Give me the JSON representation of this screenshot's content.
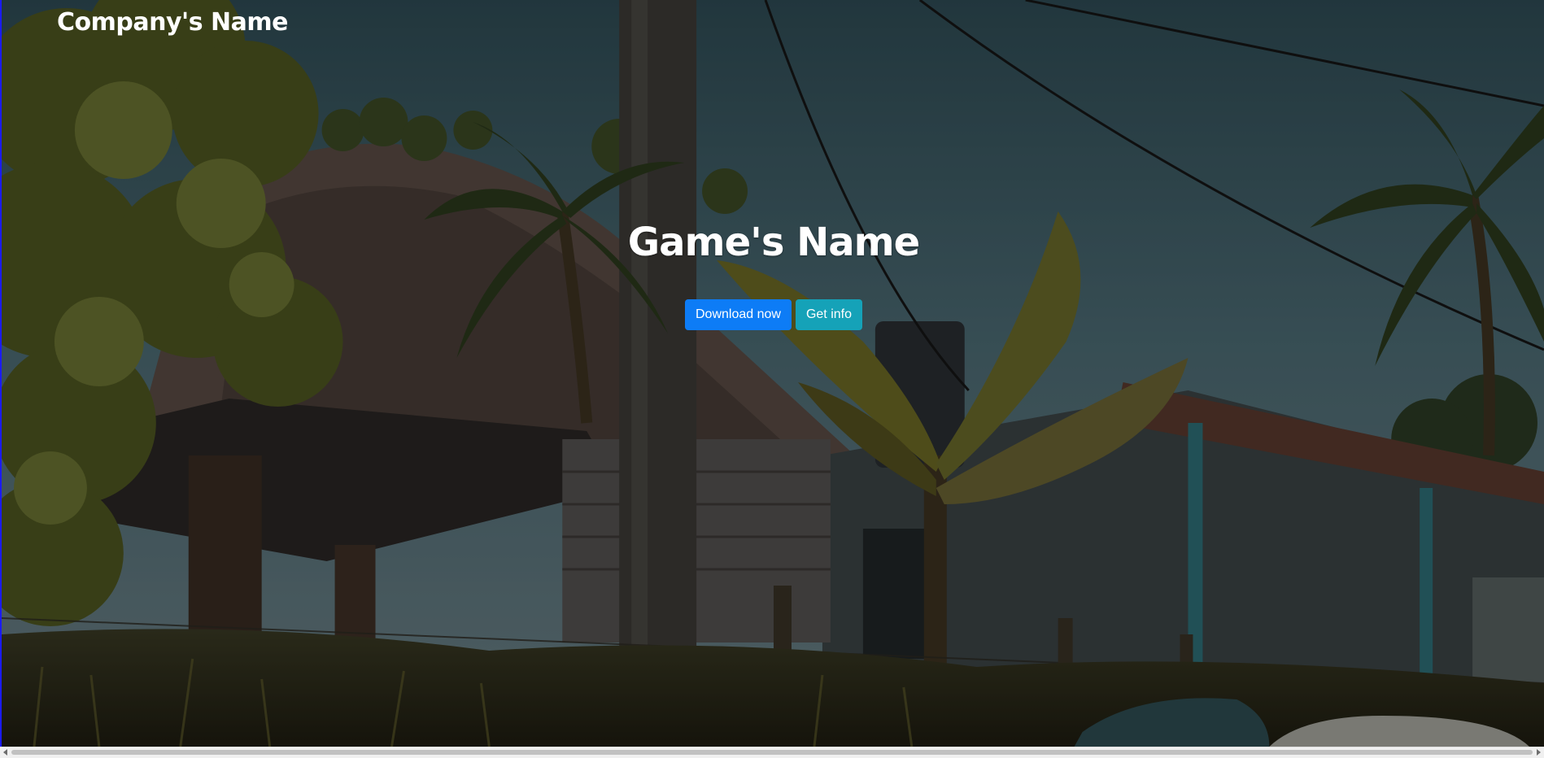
{
  "header": {
    "brand": "Company's Name"
  },
  "hero": {
    "title": "Game's Name",
    "buttons": {
      "download": "Download now",
      "info": "Get info"
    }
  },
  "colors": {
    "primary": "#0d7cf6",
    "info": "#15a2b8",
    "text": "#ffffff"
  },
  "icons": {
    "scroll_left": "chevron-left-icon",
    "scroll_right": "chevron-right-icon"
  }
}
